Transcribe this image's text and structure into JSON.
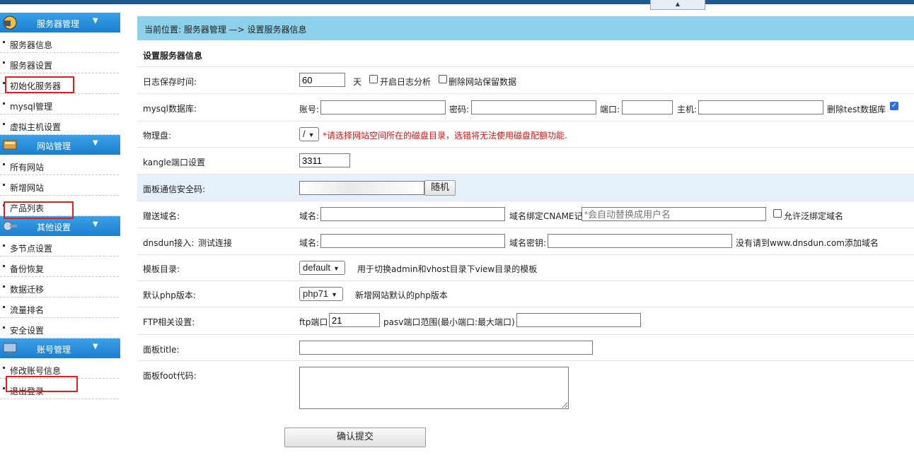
{
  "sidebar": {
    "sections": [
      {
        "title": "服务器管理",
        "items": [
          "服务器信息",
          "服务器设置",
          "初始化服务器",
          "mysql管理",
          "虚拟主机设置"
        ]
      },
      {
        "title": "网站管理",
        "items": [
          "所有网站",
          "新增网站",
          "产品列表"
        ]
      },
      {
        "title": "其他设置",
        "items": [
          "多节点设置",
          "备份恢复",
          "数据迁移",
          "流量排名",
          "安全设置"
        ]
      },
      {
        "title": "账号管理",
        "items": [
          "修改账号信息",
          "退出登录"
        ]
      }
    ],
    "arrow": "▼"
  },
  "breadcrumb": "当前位置: 服务器管理 —> 设置服务器信息",
  "form": {
    "heading": "设置服务器信息",
    "log": {
      "label": "日志保存时间:",
      "value": "60",
      "unit": "天",
      "cb1": "开启日志分析",
      "cb2": "删除网站保留数据"
    },
    "mysql": {
      "label": "mysql数据库:",
      "account": "账号:",
      "password": "密码:",
      "port": "端口:",
      "host": "主机:",
      "delete_test": "删除test数据库"
    },
    "disk": {
      "label": "物理盘:",
      "selected": "/",
      "warning": "*请选择网站空间所在的磁盘目录，选错将无法使用磁盘配额功能."
    },
    "kangle": {
      "label": "kangle端口设置",
      "value": "3311"
    },
    "panel_key": {
      "label": "面板通信安全码:",
      "button": "随机"
    },
    "gift": {
      "label": "赠送域名:",
      "domain": "域名:",
      "cname": "域名绑定CNAME记录",
      "cname_placeholder": "*会自动替换成用户名",
      "wildcard": "允许泛绑定域名"
    },
    "dnsdun": {
      "label": "dnsdun接入:",
      "link": "测试连接",
      "domain": "域名:",
      "secret": "域名密钥:",
      "note": "没有请到www.dnsdun.com添加域名"
    },
    "template": {
      "label": "模板目录:",
      "selected": "default",
      "note": "用于切换admin和vhost目录下view目录的模板"
    },
    "php": {
      "label": "默认php版本:",
      "selected": "php71",
      "note": "新增网站默认的php版本"
    },
    "ftp": {
      "label": "FTP相关设置:",
      "port_label": "ftp端口",
      "port_value": "21",
      "pasv_label": "pasv端口范围(最小端口:最大端口)"
    },
    "title": {
      "label": "面板title:"
    },
    "foot": {
      "label": "面板foot代码:"
    },
    "submit": "确认提交"
  },
  "colors": {
    "header_blue": "#1c7fd0",
    "crumb_bg": "#8dd0ea",
    "highlight_box": "#e02020"
  }
}
